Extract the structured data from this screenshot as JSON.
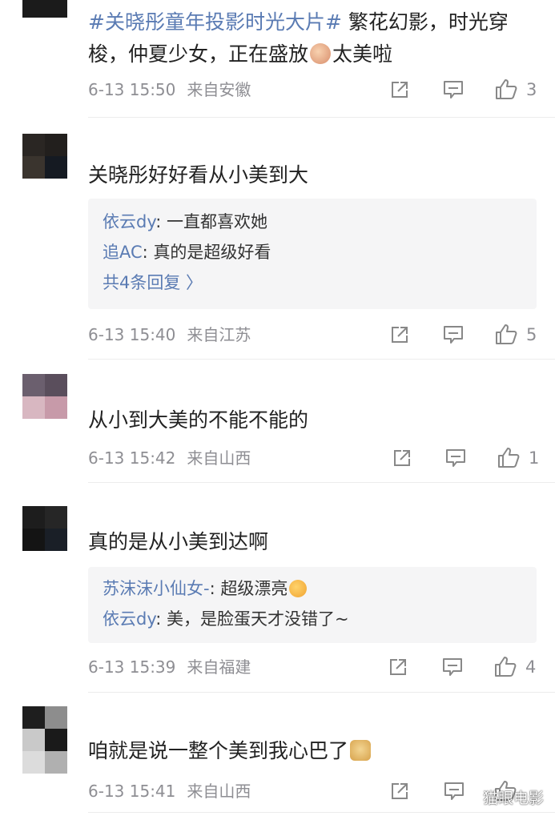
{
  "comments": [
    {
      "hashtag": "#关晓彤童年投影时光大片#",
      "text_a": " 繁花幻影，时光穿梭，仲夏少女，正在盛放",
      "text_b": "太美啦",
      "time": "6-13 15:50",
      "location": "来自安徽",
      "likes": "3"
    },
    {
      "text": "关晓彤好好看从小美到大",
      "replies": [
        {
          "user": "依云dy",
          "sep": ": ",
          "text": "一直都喜欢她"
        },
        {
          "user": "追AC",
          "sep": ": ",
          "text": "真的是超级好看"
        }
      ],
      "more": "共4条回复 〉",
      "time": "6-13 15:40",
      "location": "来自江苏",
      "likes": "5"
    },
    {
      "text": "从小到大美的不能不能的",
      "time": "6-13 15:42",
      "location": "来自山西",
      "likes": "1"
    },
    {
      "text": "真的是从小美到达啊",
      "replies": [
        {
          "user": "苏沫沫小仙女-",
          "sep": ": ",
          "text": "超级漂亮"
        },
        {
          "user": "依云dy",
          "sep": ": ",
          "text": "美，是脸蛋天才没错了~"
        }
      ],
      "time": "6-13 15:39",
      "location": "来自福建",
      "likes": "4"
    },
    {
      "text": "咱就是说一整个美到我心巴了",
      "time": "6-13 15:41",
      "location": "来自山西",
      "likes": ""
    }
  ],
  "watermark": "猫眼电影",
  "colors": {
    "link": "#5a7bb3",
    "meta": "#8e8e93",
    "reply_bg": "#f5f5f6"
  },
  "icons": [
    "share-icon",
    "comment-icon",
    "like-icon"
  ]
}
